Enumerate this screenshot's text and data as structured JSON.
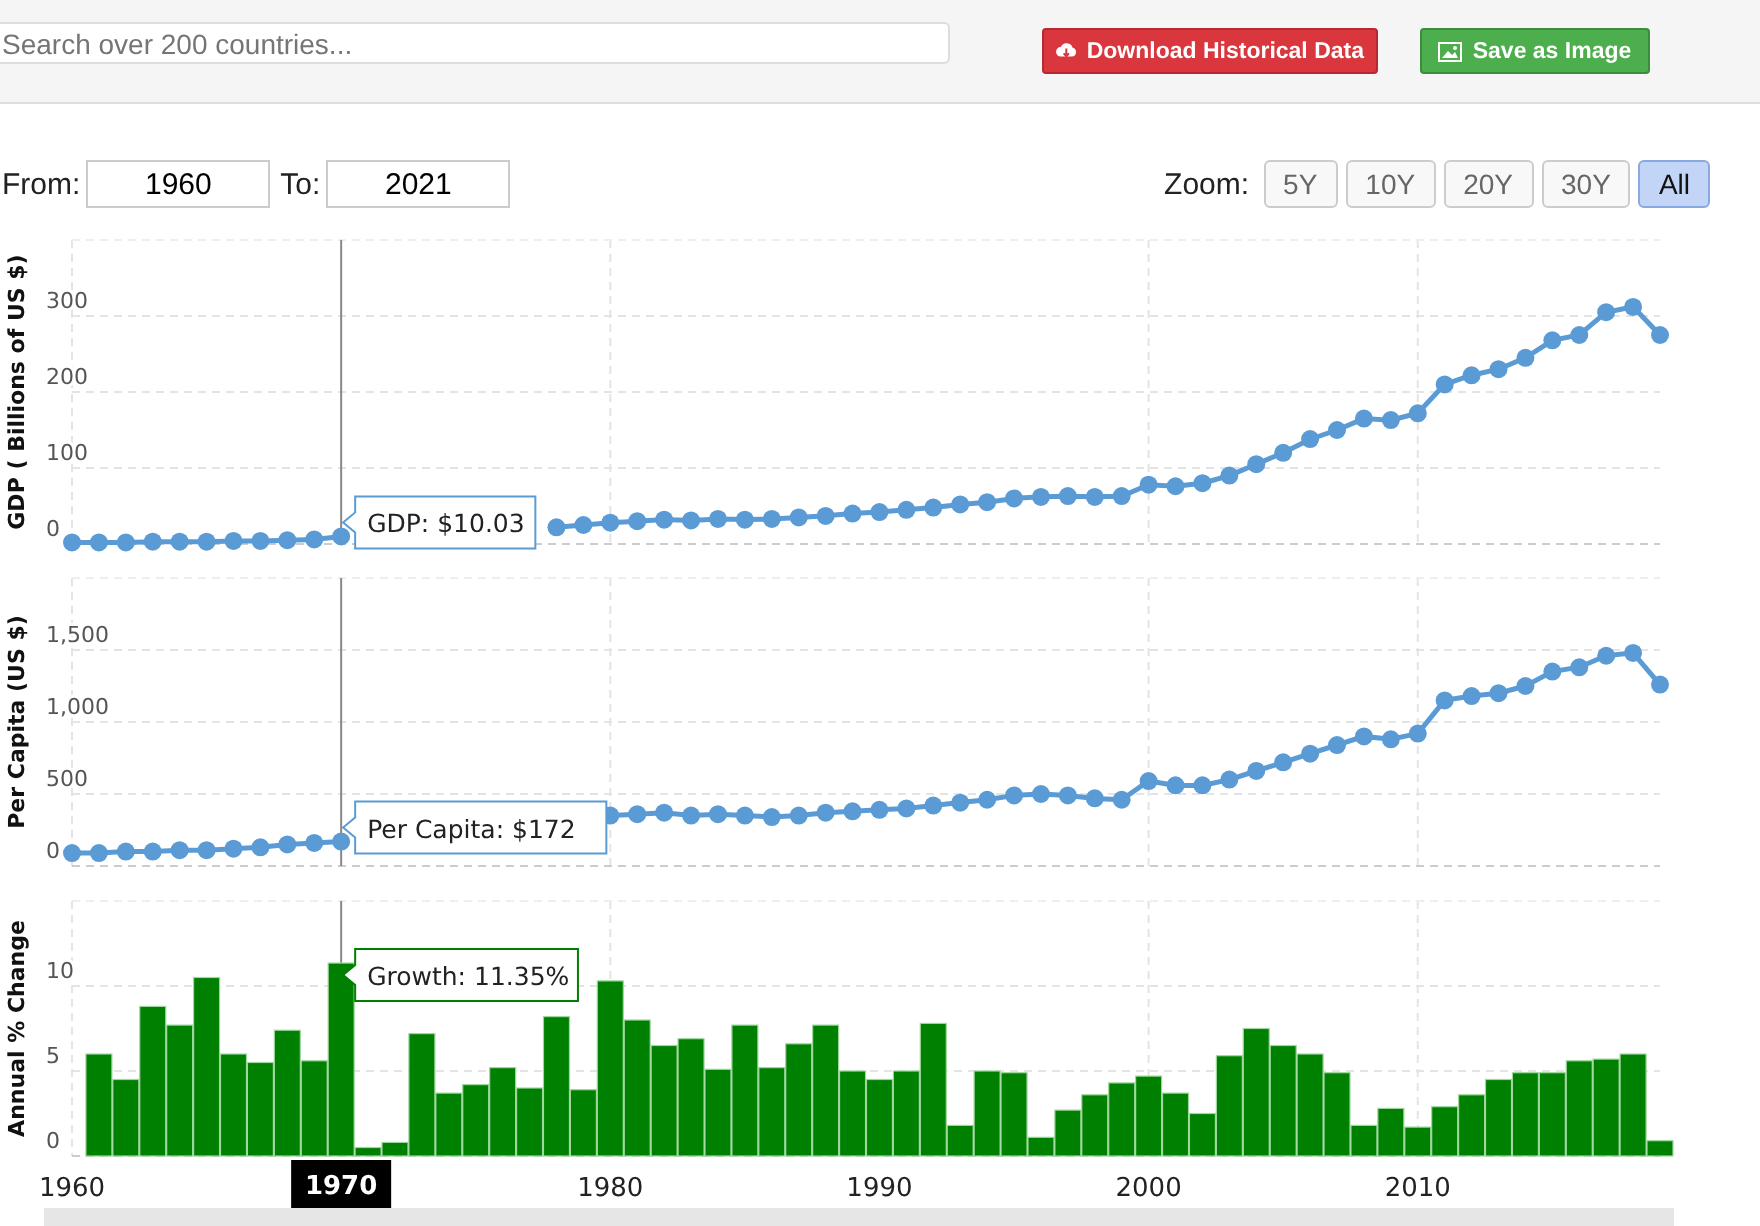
{
  "search": {
    "placeholder": "Search over 200 countries..."
  },
  "actions": [
    {
      "kind": "download",
      "label": "Download Historical Data"
    },
    {
      "kind": "image",
      "label": "Save as Image"
    }
  ],
  "range": {
    "from_label": "From:",
    "from": "1960",
    "to_label": "To:",
    "to": "2021"
  },
  "zoom": {
    "label": "Zoom:",
    "buttons": [
      {
        "label": "5Y",
        "selected": false
      },
      {
        "label": "10Y",
        "selected": false
      },
      {
        "label": "20Y",
        "selected": false
      },
      {
        "label": "30Y",
        "selected": false
      },
      {
        "label": "All",
        "selected": true
      }
    ]
  },
  "crosshair": {
    "label": "1970"
  },
  "charts": [
    {
      "chart_data": {
        "type": "line",
        "ylabel": "GDP ( Billions of US $)",
        "grid": true,
        "xlim": [
          1960,
          2019
        ],
        "ylim": [
          0,
          400
        ],
        "yticks": [
          0,
          100,
          200,
          300
        ],
        "x": [
          1960,
          1961,
          1962,
          1963,
          1964,
          1965,
          1966,
          1967,
          1968,
          1969,
          1970,
          1971,
          1972,
          1973,
          1974,
          1975,
          1976,
          1977,
          1978,
          1979,
          1980,
          1981,
          1982,
          1983,
          1984,
          1985,
          1986,
          1987,
          1988,
          1989,
          1990,
          1991,
          1992,
          1993,
          1994,
          1995,
          1996,
          1997,
          1998,
          1999,
          2000,
          2001,
          2002,
          2003,
          2004,
          2005,
          2006,
          2007,
          2008,
          2009,
          2010,
          2011,
          2012,
          2013,
          2014,
          2015,
          2016,
          2017,
          2018,
          2019
        ],
        "series": [
          {
            "color": "#5b9bd5",
            "marker": "circle",
            "values": [
              2,
              2,
              2,
              3,
              3,
              3,
              4,
              4,
              5,
              6,
              10,
              null,
              null,
              null,
              null,
              null,
              null,
              null,
              22,
              25,
              28,
              30,
              32,
              31,
              33,
              32,
              33,
              35,
              37,
              40,
              42,
              45,
              48,
              52,
              55,
              60,
              62,
              63,
              62,
              63,
              78,
              76,
              80,
              90,
              105,
              120,
              138,
              150,
              165,
              163,
              172,
              210,
              222,
              230,
              245,
              268,
              275,
              305,
              312,
              275
            ]
          }
        ],
        "ref_lines": [
          {
            "axis": "x",
            "value": 1970
          }
        ],
        "annotations": [
          "GDP: $10.03"
        ]
      }
    },
    {
      "chart_data": {
        "type": "line",
        "ylabel": "Per Capita (US $)",
        "grid": true,
        "xlim": [
          1960,
          2019
        ],
        "ylim": [
          0,
          2000
        ],
        "yticks": [
          0,
          {
            "value": 500,
            "label": "500"
          },
          {
            "value": 1000,
            "label": "1,000"
          },
          {
            "value": 1500,
            "label": "1,500"
          }
        ],
        "x": [
          1960,
          1961,
          1962,
          1963,
          1964,
          1965,
          1966,
          1967,
          1968,
          1969,
          1970,
          1971,
          1972,
          1973,
          1974,
          1975,
          1976,
          1977,
          1978,
          1979,
          1980,
          1981,
          1982,
          1983,
          1984,
          1985,
          1986,
          1987,
          1988,
          1989,
          1990,
          1991,
          1992,
          1993,
          1994,
          1995,
          1996,
          1997,
          1998,
          1999,
          2000,
          2001,
          2002,
          2003,
          2004,
          2005,
          2006,
          2007,
          2008,
          2009,
          2010,
          2011,
          2012,
          2013,
          2014,
          2015,
          2016,
          2017,
          2018,
          2019
        ],
        "series": [
          {
            "color": "#5b9bd5",
            "marker": "circle",
            "values": [
              90,
              90,
              100,
              100,
              110,
              110,
              120,
              130,
              150,
              160,
              170,
              null,
              null,
              null,
              null,
              null,
              null,
              null,
              null,
              null,
              350,
              360,
              370,
              350,
              360,
              350,
              340,
              350,
              370,
              380,
              390,
              400,
              420,
              440,
              460,
              490,
              500,
              490,
              470,
              460,
              590,
              560,
              560,
              600,
              660,
              720,
              780,
              840,
              900,
              880,
              920,
              1150,
              1180,
              1200,
              1250,
              1350,
              1380,
              1460,
              1480,
              1260
            ]
          }
        ],
        "ref_lines": [
          {
            "axis": "x",
            "value": 1970
          }
        ],
        "annotations": [
          "Per Capita: $172"
        ]
      }
    },
    {
      "chart_data": {
        "type": "bar",
        "ylabel": "Annual % Change",
        "grid": true,
        "xlim": [
          1960,
          2019
        ],
        "ylim": [
          0,
          15
        ],
        "yticks": [
          0,
          5,
          10
        ],
        "xticks": [
          1960,
          1970,
          1980,
          1990,
          2000,
          2010
        ],
        "x": [
          1961,
          1962,
          1963,
          1964,
          1965,
          1966,
          1967,
          1968,
          1969,
          1970,
          1971,
          1972,
          1973,
          1974,
          1975,
          1976,
          1977,
          1978,
          1979,
          1980,
          1981,
          1982,
          1983,
          1984,
          1985,
          1986,
          1987,
          1988,
          1989,
          1990,
          1991,
          1992,
          1993,
          1994,
          1995,
          1996,
          1997,
          1998,
          1999,
          2000,
          2001,
          2002,
          2003,
          2004,
          2005,
          2006,
          2007,
          2008,
          2009,
          2010,
          2011,
          2012,
          2013,
          2014,
          2015,
          2016,
          2017,
          2018,
          2019
        ],
        "series": [
          {
            "color": "#008000",
            "values": [
              6.0,
              4.5,
              8.8,
              7.7,
              10.5,
              6.0,
              5.5,
              7.4,
              5.6,
              11.35,
              0.5,
              0.8,
              7.2,
              3.7,
              4.2,
              5.2,
              4.0,
              8.2,
              3.9,
              10.3,
              8.0,
              6.5,
              6.9,
              5.1,
              7.7,
              5.2,
              6.6,
              7.7,
              5.0,
              4.5,
              5.0,
              7.8,
              1.8,
              5.0,
              4.9,
              1.1,
              2.7,
              3.6,
              4.3,
              4.7,
              3.7,
              2.5,
              5.9,
              7.5,
              6.5,
              6.0,
              4.9,
              1.8,
              2.8,
              1.7,
              2.9,
              3.6,
              4.5,
              4.9,
              4.9,
              5.6,
              5.7,
              6.0,
              0.9
            ]
          }
        ],
        "ref_lines": [
          {
            "axis": "x",
            "value": 1970
          }
        ],
        "annotations": [
          "Growth: 11.35%"
        ]
      }
    }
  ]
}
